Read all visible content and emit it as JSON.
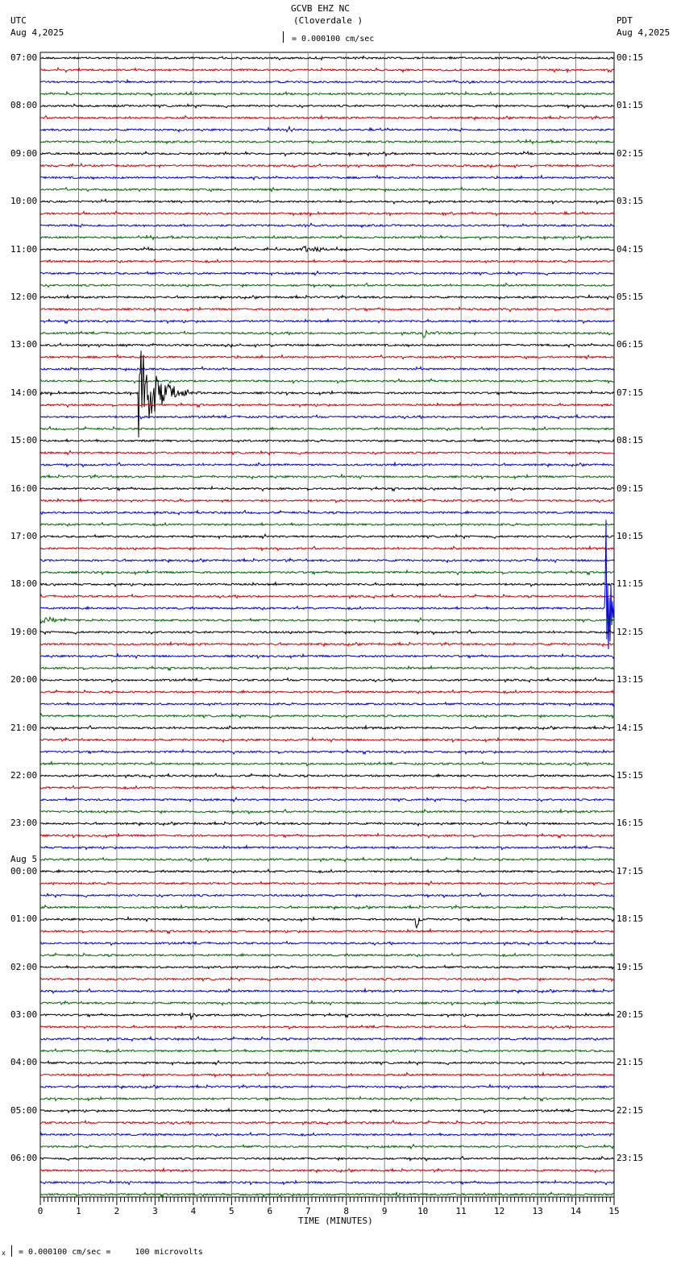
{
  "header": {
    "title": "GCVB EHZ NC",
    "subtitle": "(Cloverdale )",
    "scale": "= 0.000100 cm/sec",
    "left_tz": "UTC",
    "left_date": "Aug 4,2025",
    "right_tz": "PDT",
    "right_date": "Aug 4,2025"
  },
  "footer": {
    "scale_note": "= 0.000100 cm/sec =     100 microvolts",
    "corner_mark": "x"
  },
  "chart_data": {
    "type": "line",
    "title": "GCVB EHZ NC (Cloverdale )",
    "xlabel": "TIME (MINUTES)",
    "xlim": [
      0,
      15
    ],
    "xticks": [
      "0",
      "1",
      "2",
      "3",
      "4",
      "5",
      "6",
      "7",
      "8",
      "9",
      "10",
      "11",
      "12",
      "13",
      "14",
      "15"
    ],
    "traces_per_hour": 4,
    "trace_count": 96,
    "trace_colors": [
      "#000000",
      "#cc0000",
      "#0000cc",
      "#006600"
    ],
    "left_labels": [
      "07:00",
      "08:00",
      "09:00",
      "10:00",
      "11:00",
      "12:00",
      "13:00",
      "14:00",
      "15:00",
      "16:00",
      "17:00",
      "18:00",
      "19:00",
      "20:00",
      "21:00",
      "22:00",
      "23:00",
      "00:00",
      "01:00",
      "02:00",
      "03:00",
      "04:00",
      "05:00",
      "06:00"
    ],
    "date_change_label": "Aug 5",
    "right_labels": [
      "00:15",
      "01:15",
      "02:15",
      "03:15",
      "04:15",
      "05:15",
      "06:15",
      "07:15",
      "08:15",
      "09:15",
      "10:15",
      "11:15",
      "12:15",
      "13:15",
      "14:15",
      "15:15",
      "16:15",
      "17:15",
      "18:15",
      "19:15",
      "20:15",
      "21:15",
      "22:15",
      "23:15"
    ],
    "events": [
      {
        "trace": 6,
        "minute": 6.5,
        "amplitude": 4,
        "duration": 0.2
      },
      {
        "trace": 16,
        "minute": 6.8,
        "amplitude": 4,
        "duration": 1.0
      },
      {
        "trace": 23,
        "minute": 10.0,
        "amplitude": 6,
        "duration": 0.3
      },
      {
        "trace": 28,
        "minute": 2.55,
        "amplitude": 75,
        "duration": 0.8
      },
      {
        "trace": 46,
        "minute": 14.75,
        "amplitude": 170,
        "duration": 0.25
      },
      {
        "trace": 47,
        "minute": 0.0,
        "amplitude": 7,
        "duration": 0.6
      },
      {
        "trace": 72,
        "minute": 9.8,
        "amplitude": 16,
        "duration": 0.2
      },
      {
        "trace": 80,
        "minute": 3.9,
        "amplitude": 8,
        "duration": 0.3
      },
      {
        "trace": 95,
        "minute": 9.3,
        "amplitude": 5,
        "duration": 0.4
      }
    ]
  }
}
